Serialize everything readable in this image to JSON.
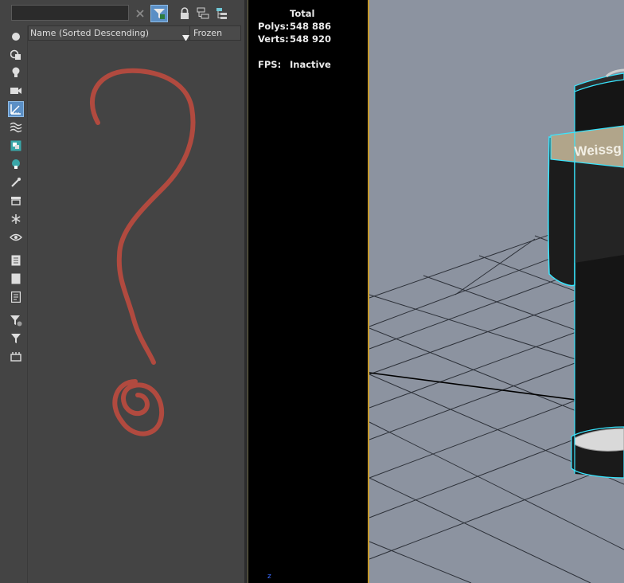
{
  "explorer": {
    "search": {
      "value": "",
      "placeholder": ""
    },
    "columns": {
      "name": "Name (Sorted Descending)",
      "frozen": "Frozen"
    }
  },
  "viewport": {
    "stats": {
      "total_label": "Total",
      "polys_label": "Polys:",
      "polys_value": "548 886",
      "verts_label": "Verts:",
      "verts_value": "548 920",
      "fps_label": "FPS:",
      "fps_value": "Inactive"
    },
    "object_label": "Weissg",
    "axis_label": "z"
  },
  "icons": {
    "toolbar": [
      "clear-search-icon",
      "filter-icon",
      "lock-icon",
      "hierarchy-icon",
      "layer-hierarchy-icon"
    ],
    "left": [
      "geometry-icon",
      "shapes-icon",
      "light-icon",
      "camera-icon",
      "helpers-icon",
      "spacewarps-icon",
      "groups-icon",
      "xrefs-icon",
      "bones-icon",
      "containers-icon",
      "frozen-icon",
      "hidden-icon",
      "display-all-icon",
      "display-none-icon",
      "invert-icon",
      "filter-settings-icon",
      "filter-icon",
      "select-children-icon"
    ]
  },
  "colors": {
    "accent": "#5b8fc5",
    "viewport_border": "#c69a2e",
    "annotation": "#b14a3f",
    "selection_outline": "#38e6ff"
  }
}
